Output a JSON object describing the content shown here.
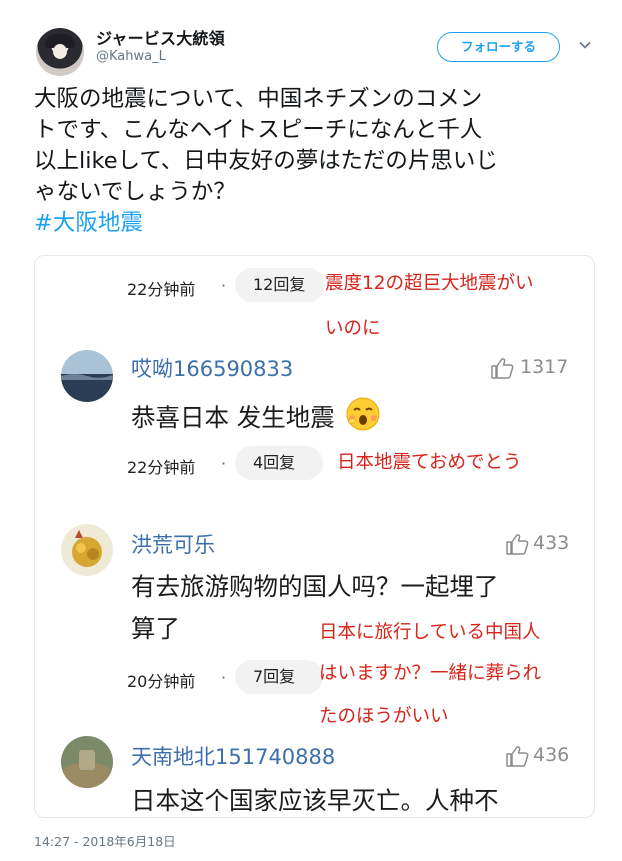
{
  "tweet": {
    "display_name": "ジャービス大統領",
    "handle": "@Kahwa_L",
    "follow_label": "フォローする",
    "text_lines": [
      "大阪の地震について、中国ネチズンのコメン",
      "トです、こんなヘイトスピーチになんと千人",
      "以上likeして、日中友好の夢はただの片思いじ",
      "ゃないでしょうか？"
    ],
    "hashtag": "#大阪地震",
    "timestamp": "14:27 - 2018年6月18日"
  },
  "embedded": {
    "top_meta": {
      "time": "22分钟前",
      "dot": "·",
      "replies": "12回复"
    },
    "top_annotation": [
      "震度12の超巨大地震がい",
      "いのに"
    ],
    "comments": [
      {
        "user": "哎呦166590833",
        "likes": "1317",
        "body": [
          "恭喜日本 发生地震"
        ],
        "time": "22分钟前",
        "dot": "·",
        "replies": "4回复",
        "annotation": [
          "日本地震ておめでとう"
        ]
      },
      {
        "user": "洪荒可乐",
        "likes": "433",
        "body": [
          "有去旅游购物的国人吗？一起埋了",
          "算了"
        ],
        "time": "20分钟前",
        "dot": "·",
        "replies": "7回复",
        "annotation": [
          "日本に旅行している中国人",
          "はいますか？一緒に葬られ",
          "たのほうがいい"
        ]
      },
      {
        "user": "天南地北151740888",
        "likes": "436",
        "body": [
          "日本这个国家应该早灭亡。人种不"
        ]
      }
    ]
  },
  "colors": {
    "accent": "#1da1f2",
    "username_blue": "#3e6fad",
    "annotation_red": "#d8251c",
    "muted": "#657786"
  },
  "icons": [
    "caret-down-icon",
    "thumbs-up-icon",
    "emoji-face-icon"
  ]
}
